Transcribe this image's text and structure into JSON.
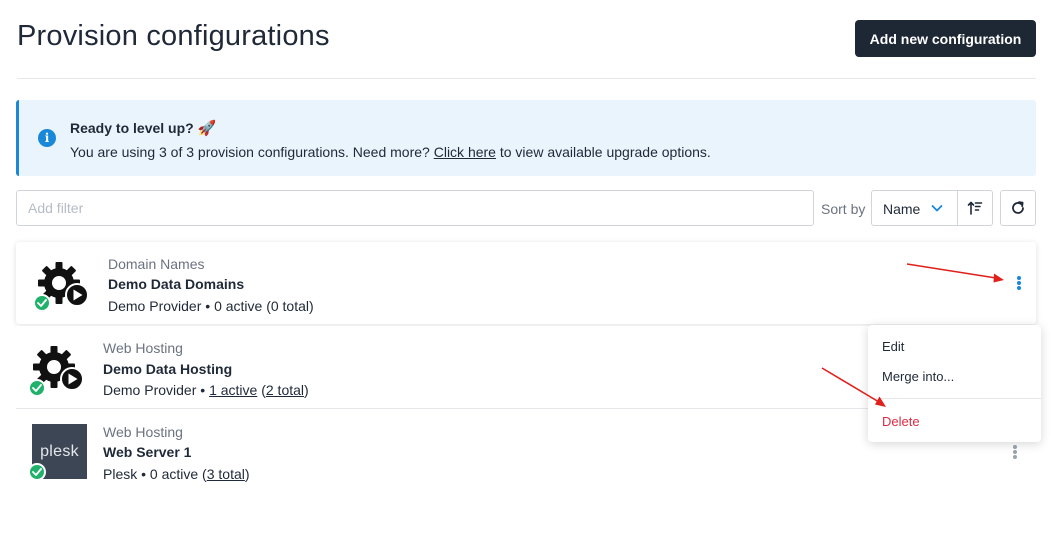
{
  "header": {
    "title": "Provision configurations",
    "add_button_label": "Add new configuration"
  },
  "alert": {
    "icon": "info-icon",
    "title": "Ready to level up?",
    "emoji": "🚀",
    "text_before": "You are using 3 of 3 provision configurations. Need more? ",
    "link_label": "Click here",
    "text_after": " to view available upgrade options."
  },
  "toolbar": {
    "filter_placeholder": "Add filter",
    "sort_label": "Sort by",
    "sort_value": "Name",
    "sort_direction_icon": "sort-ascending-icon",
    "refresh_icon": "refresh-icon"
  },
  "configurations": [
    {
      "category": "Domain Names",
      "name": "Demo Data Domains",
      "provider": "Demo Provider",
      "active": "0 active",
      "total": "(0 total)",
      "icon": "gear-play-icon",
      "status": "check-icon"
    },
    {
      "category": "Web Hosting",
      "name": "Demo Data Hosting",
      "provider": "Demo Provider",
      "active": "1 active",
      "total": "2 total",
      "icon": "gear-play-icon",
      "status": "check-icon"
    },
    {
      "category": "Web Hosting",
      "name": "Web Server 1",
      "provider": "Plesk",
      "active": "0 active",
      "total": "3 total",
      "icon": "plesk-logo",
      "logo_text": "plesk",
      "status": "check-icon"
    }
  ],
  "separator": " • ",
  "context_menu": {
    "items": [
      "Edit",
      "Merge into...",
      "Delete"
    ]
  },
  "colors": {
    "primary_button": "#1e2734",
    "info_accent": "#1a88d8",
    "alert_background": "#eaf4fd",
    "success": "#20b26a",
    "danger": "#dc2b44",
    "annotation_arrow": "#e0201b"
  }
}
